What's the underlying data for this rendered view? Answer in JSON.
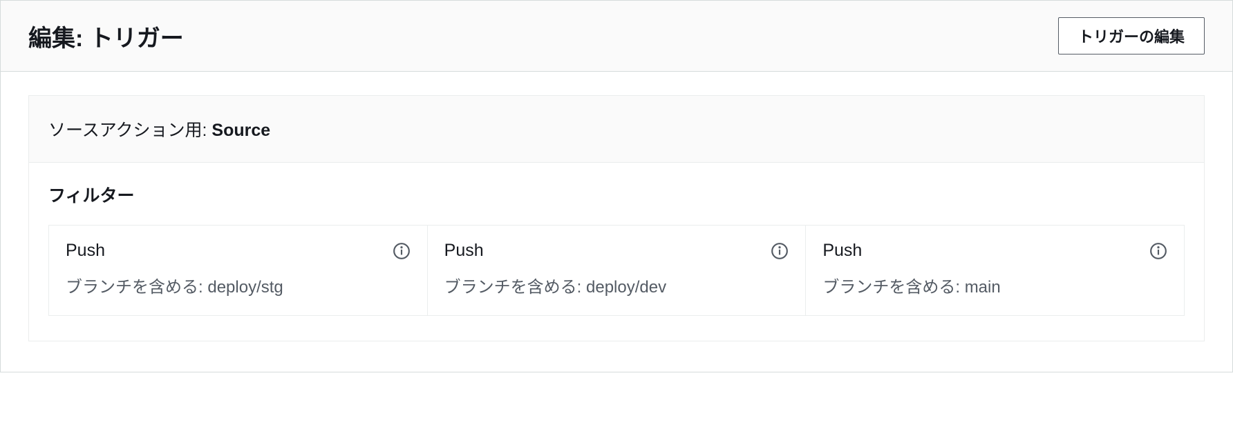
{
  "header": {
    "title": "編集: トリガー",
    "edit_button_label": "トリガーの編集"
  },
  "panel": {
    "source_action_prefix": "ソースアクション用: ",
    "source_name": "Source",
    "filters_title": "フィルター",
    "filters": [
      {
        "type": "Push",
        "branch_prefix": "ブランチを含める: ",
        "branch": "deploy/stg"
      },
      {
        "type": "Push",
        "branch_prefix": "ブランチを含める: ",
        "branch": "deploy/dev"
      },
      {
        "type": "Push",
        "branch_prefix": "ブランチを含める: ",
        "branch": "main"
      }
    ]
  }
}
